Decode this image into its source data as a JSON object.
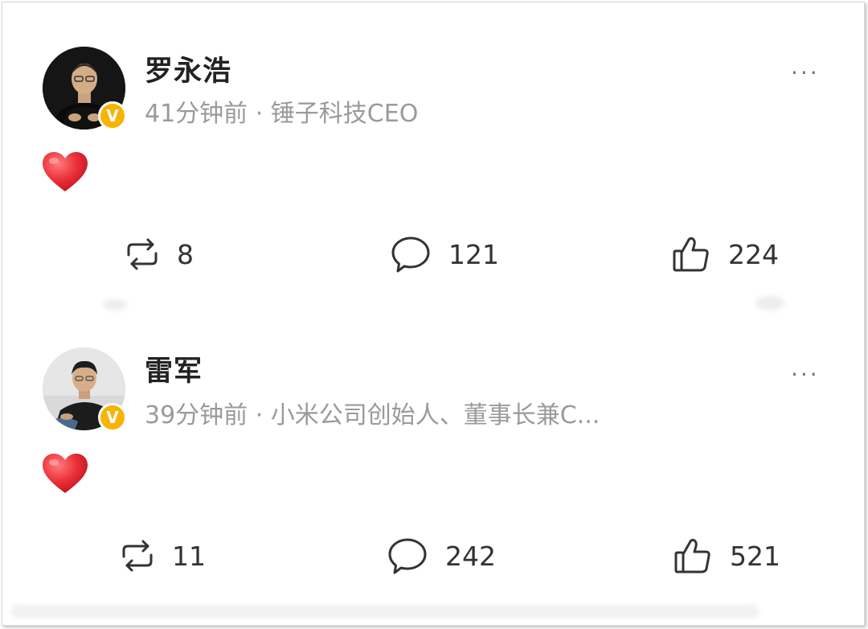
{
  "posts": [
    {
      "author": "罗永浩",
      "time": "41分钟前",
      "separator": " · ",
      "bio": "锤子科技CEO",
      "more_label": "···",
      "verified_mark": "V",
      "content_emoji": "heart",
      "reposts": "8",
      "comments": "121",
      "likes": "224"
    },
    {
      "author": "雷军",
      "time": "39分钟前",
      "separator": " · ",
      "bio": "小米公司创始人、董事长兼C...",
      "more_label": "···",
      "verified_mark": "V",
      "content_emoji": "heart",
      "reposts": "11",
      "comments": "242",
      "likes": "521"
    }
  ],
  "icons": {
    "repost": "repost-icon",
    "comment": "comment-icon",
    "like": "thumbs-up-icon",
    "verified": "verified-badge-icon",
    "heart": "heart-emoji-icon"
  },
  "colors": {
    "badge": "#f6b400",
    "heart": "#e8303a",
    "meta_text": "#9a9a9a",
    "name_text": "#222222"
  }
}
